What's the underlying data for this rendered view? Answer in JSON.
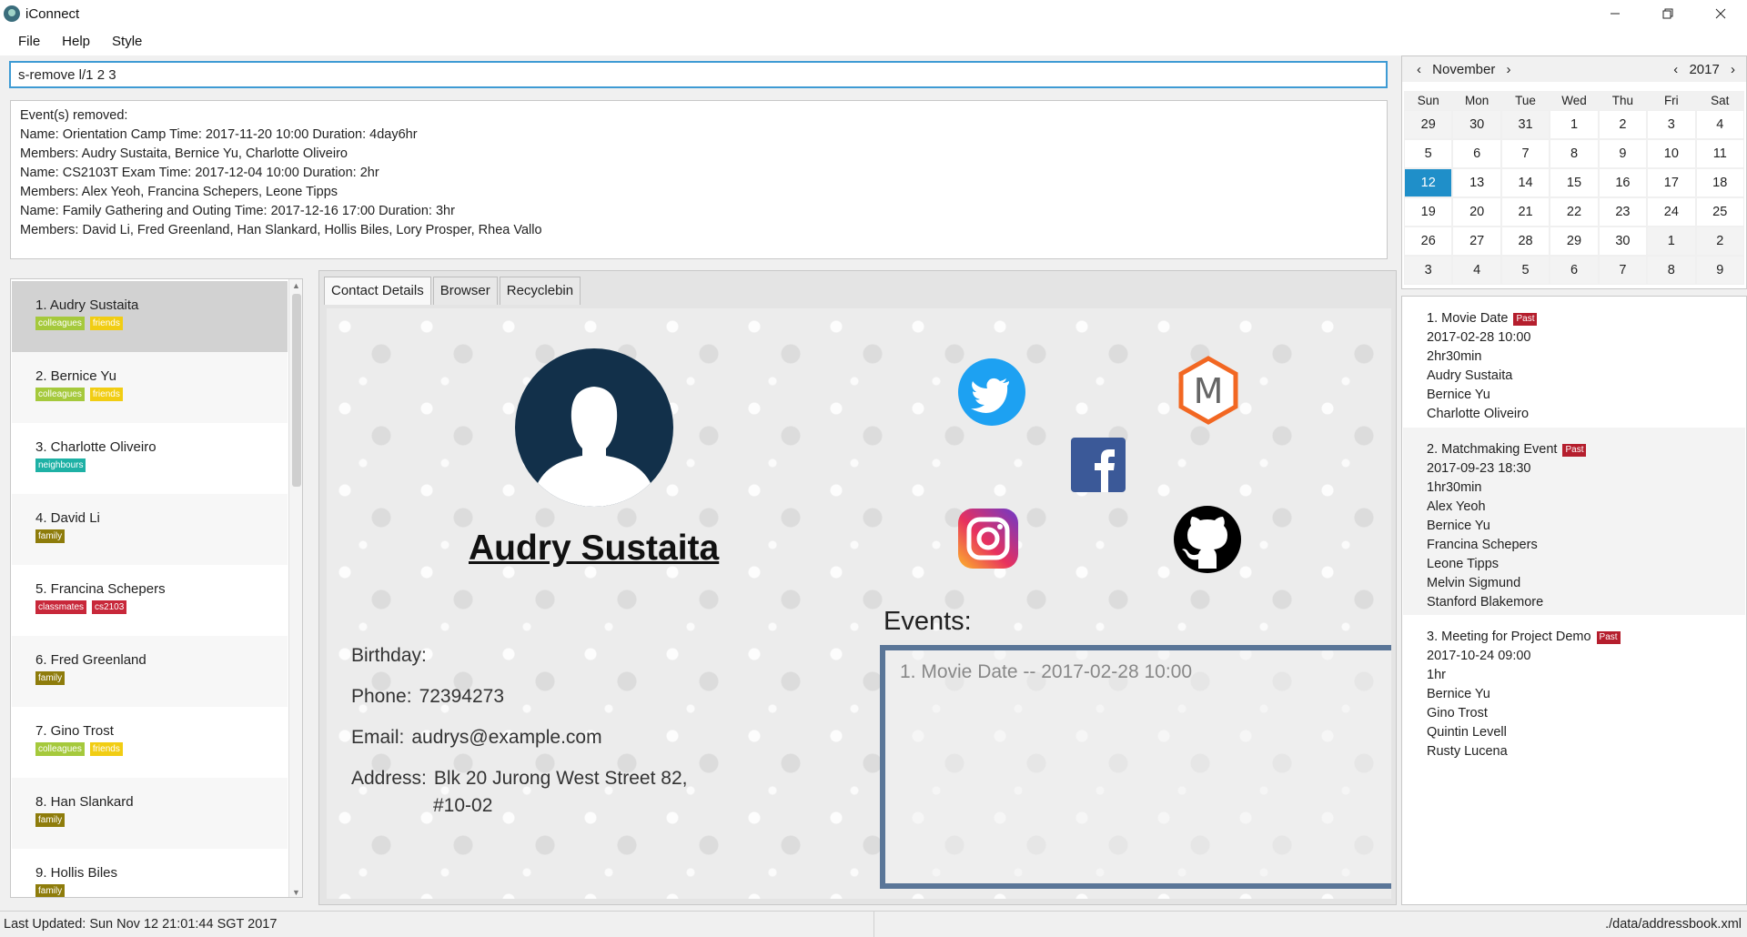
{
  "app": {
    "title": "iConnect",
    "window_controls": [
      "minimize",
      "restore",
      "close"
    ]
  },
  "menu": {
    "items": [
      "File",
      "Help",
      "Style"
    ]
  },
  "command": {
    "value": "s-remove l/1 2 3"
  },
  "result": {
    "lines": [
      "Event(s) removed:",
      "Name: Orientation Camp Time: 2017-11-20 10:00 Duration: 4day6hr",
      "Members: Audry Sustaita, Bernice Yu, Charlotte Oliveiro",
      "Name: CS2103T Exam Time: 2017-12-04 10:00 Duration: 2hr",
      "Members: Alex Yeoh, Francina Schepers, Leone Tipps",
      "Name: Family Gathering and Outing Time: 2017-12-16 17:00 Duration: 3hr",
      "Members: David Li, Fred Greenland, Han Slankard, Hollis Biles, Lory Prosper, Rhea Vallo"
    ]
  },
  "contacts": [
    {
      "label": "1.  Audry Sustaita",
      "tags": [
        "colleagues",
        "friends"
      ]
    },
    {
      "label": "2.  Bernice Yu",
      "tags": [
        "colleagues",
        "friends"
      ]
    },
    {
      "label": "3.  Charlotte Oliveiro",
      "tags": [
        "neighbours"
      ]
    },
    {
      "label": "4.  David Li",
      "tags": [
        "family"
      ]
    },
    {
      "label": "5.  Francina Schepers",
      "tags": [
        "classmates",
        "cs2103"
      ]
    },
    {
      "label": "6.  Fred Greenland",
      "tags": [
        "family"
      ]
    },
    {
      "label": "7.  Gino Trost",
      "tags": [
        "colleagues",
        "friends"
      ]
    },
    {
      "label": "8.  Han Slankard",
      "tags": [
        "family"
      ]
    },
    {
      "label": "9.  Hollis Biles",
      "tags": [
        "family"
      ]
    }
  ],
  "tabs": {
    "details": "Contact Details",
    "browser": "Browser",
    "recycle": "Recyclebin",
    "selected": "Contact Details"
  },
  "person": {
    "name": "Audry Sustaita",
    "birthday_label": "Birthday:",
    "birthday": "",
    "phone_label": "Phone:",
    "phone": "72394273",
    "email_label": "Email:",
    "email": "audrys@example.com",
    "address_label": "Address:",
    "address_line1": "Blk 20 Jurong West Street 82,",
    "address_line2": "#10-02",
    "events_label": "Events:",
    "events": [
      "1. Movie Date -- 2017-02-28 10:00"
    ]
  },
  "social": {
    "icons": [
      "twitter-icon",
      "meetup-icon",
      "facebook-icon",
      "instagram-icon",
      "github-icon"
    ],
    "colors": {
      "twitter": "#1da1f2",
      "facebook": "#3b5998",
      "meetup": "#f26722",
      "github": "#000000"
    }
  },
  "calendar": {
    "month": "November",
    "year": "2017",
    "days": [
      "Sun",
      "Mon",
      "Tue",
      "Wed",
      "Thu",
      "Fri",
      "Sat"
    ],
    "weeks": [
      [
        "29",
        "30",
        "31",
        "1",
        "2",
        "3",
        "4"
      ],
      [
        "5",
        "6",
        "7",
        "8",
        "9",
        "10",
        "11"
      ],
      [
        "12",
        "13",
        "14",
        "15",
        "16",
        "17",
        "18"
      ],
      [
        "19",
        "20",
        "21",
        "22",
        "23",
        "24",
        "25"
      ],
      [
        "26",
        "27",
        "28",
        "29",
        "30",
        "1",
        "2"
      ],
      [
        "3",
        "4",
        "5",
        "6",
        "7",
        "8",
        "9"
      ]
    ],
    "today": "12",
    "accent": "#1f8fc9"
  },
  "events": [
    {
      "title": "1.  Movie Date",
      "badge": "Past",
      "time": "2017-02-28 10:00",
      "duration": "2hr30min",
      "members": [
        "Audry Sustaita",
        "Bernice Yu",
        "Charlotte Oliveiro"
      ]
    },
    {
      "title": "2.  Matchmaking Event",
      "badge": "Past",
      "time": "2017-09-23 18:30",
      "duration": "1hr30min",
      "members": [
        "Alex Yeoh",
        "Bernice Yu",
        "Francina Schepers",
        "Leone Tipps",
        "Melvin Sigmund",
        "Stanford Blakemore"
      ]
    },
    {
      "title": "3.  Meeting for Project Demo",
      "badge": "Past",
      "time": "2017-10-24 09:00",
      "duration": "1hr",
      "members": [
        "Bernice Yu",
        "Gino Trost",
        "Quintin Levell",
        "Rusty Lucena"
      ]
    }
  ],
  "status": {
    "left": "Last Updated: Sun Nov 12 21:01:44 SGT 2017",
    "right": "./data/addressbook.xml"
  }
}
